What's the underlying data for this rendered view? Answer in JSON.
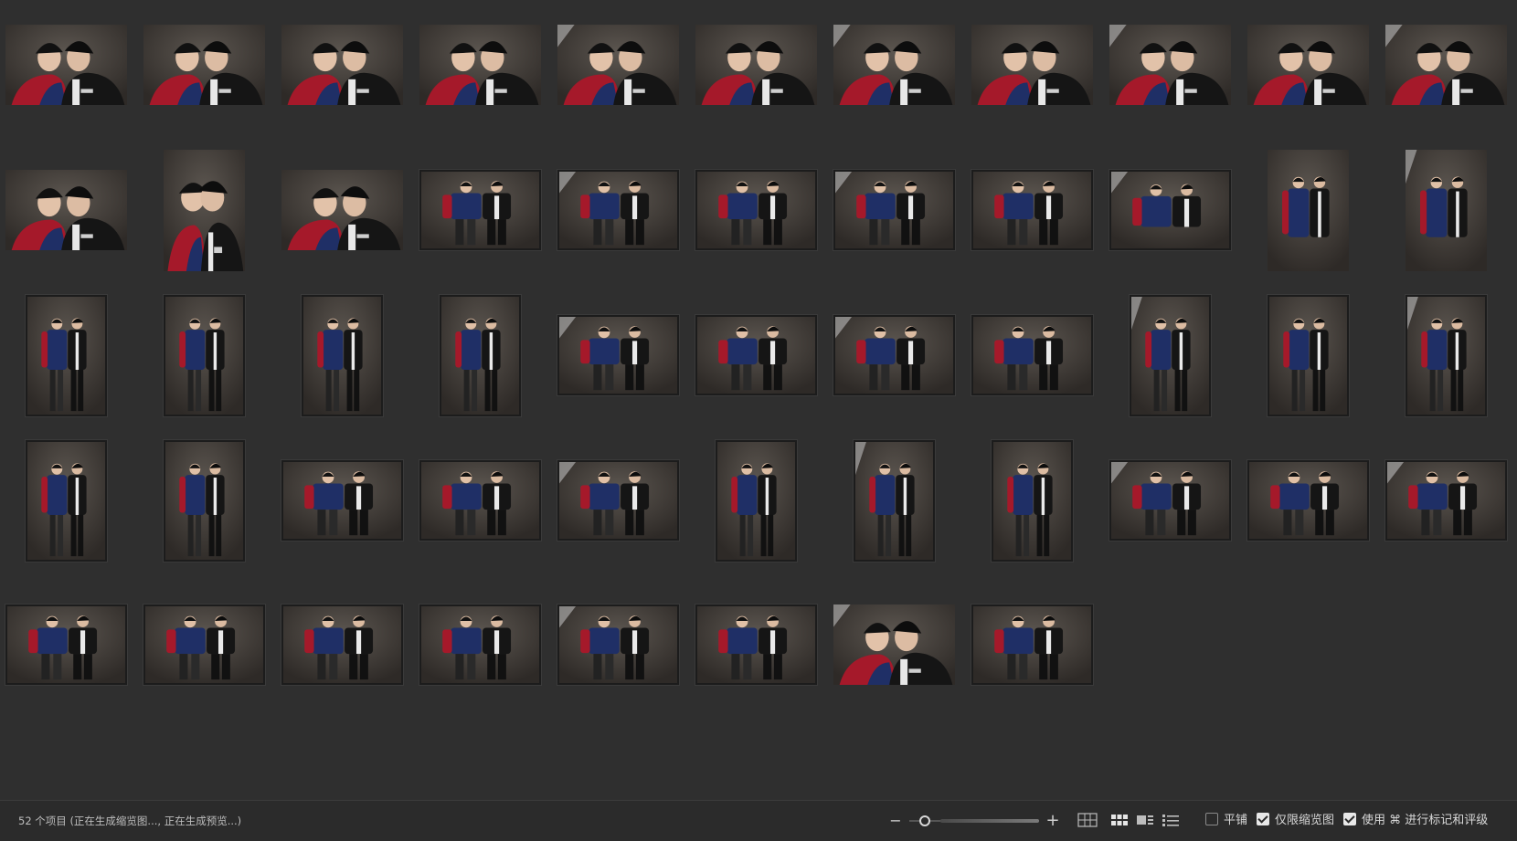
{
  "status_text": "52 个项目 (正在生成缩览图..., 正在生成预览...)",
  "zoom": {
    "out_label": "−",
    "in_label": "+",
    "level": 0.1
  },
  "view_modes": [
    "grid-large-icon",
    "grid-small-icon",
    "filmstrip-icon",
    "list-icon"
  ],
  "options": {
    "tile": {
      "label": "平铺",
      "checked": false
    },
    "thumbs_only": {
      "label": "仅限缩览图",
      "checked": true
    },
    "use_marks": {
      "label": "使用 ⌘ 进行标记和评级",
      "checked": true
    }
  },
  "colors": {
    "background": "#2f2f2f",
    "red_jacket": "#a5192a",
    "navy_jacket": "#1f2f66",
    "black_jacket": "#151515",
    "studio_backdrop": "#4a443f"
  },
  "rows": [
    [
      "LS",
      "LS",
      "LS",
      "LS",
      "LS",
      "LS",
      "LS",
      "LS",
      "LS",
      "LS",
      "LS"
    ],
    [
      "LS",
      "PS",
      "LS",
      "LF",
      "LF",
      "LF",
      "LF",
      "LF",
      "LB",
      "PB",
      "PB"
    ],
    [
      "PF",
      "PF",
      "PF",
      "PF",
      "LF",
      "LF",
      "LF",
      "LF",
      "PF",
      "PF",
      "PF"
    ],
    [
      "PF",
      "PF",
      "LF",
      "LF",
      "LF",
      "PF",
      "PF",
      "PF",
      "LF",
      "LF",
      "LF"
    ],
    [
      "LF",
      "LF",
      "LF",
      "LF",
      "LF",
      "LF",
      "LS",
      "LF"
    ]
  ]
}
